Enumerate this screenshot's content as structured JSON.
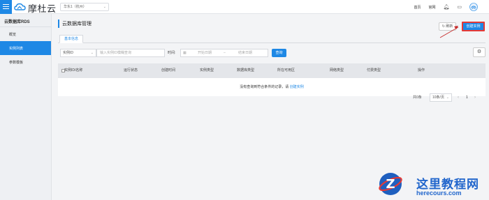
{
  "header": {
    "logo_text": "摩杜云",
    "region": "华东1（杭州）",
    "links": [
      "首页",
      "官网"
    ],
    "icons": [
      "bell-icon",
      "monitor-icon",
      "user-avatar-icon"
    ]
  },
  "sidebar": {
    "title": "云数据库RDS",
    "items": [
      {
        "label": "概览",
        "active": false
      },
      {
        "label": "实例列表",
        "active": true
      },
      {
        "label": "参数模板",
        "active": false
      }
    ]
  },
  "page": {
    "title": "云数据库管理",
    "refresh_label": "刷新",
    "create_label": "创建实例",
    "tab_label": "基本信息"
  },
  "filter": {
    "field_select": "实例ID",
    "search_placeholder": "输入实例ID模糊查询",
    "time_label": "时间:",
    "start_placeholder": "开始日期",
    "range_sep": "–",
    "end_placeholder": "结束日期",
    "search_button": "查询"
  },
  "table": {
    "columns": [
      "实例ID/名称",
      "运行状态",
      "创建时间",
      "实例类型",
      "数据库类型",
      "所在可用区",
      "网络类型",
      "付费类型",
      "操作"
    ],
    "empty_text": "没有查询到符合条件的记录，请",
    "empty_link": "创建实例"
  },
  "pagination": {
    "total": "共0条",
    "page_size": "10条/页",
    "page": "1"
  },
  "colors": {
    "accent": "#1e88e5",
    "highlight": "#e53935"
  },
  "watermark": {
    "title": "这里教程网",
    "url": "herecours.com"
  }
}
